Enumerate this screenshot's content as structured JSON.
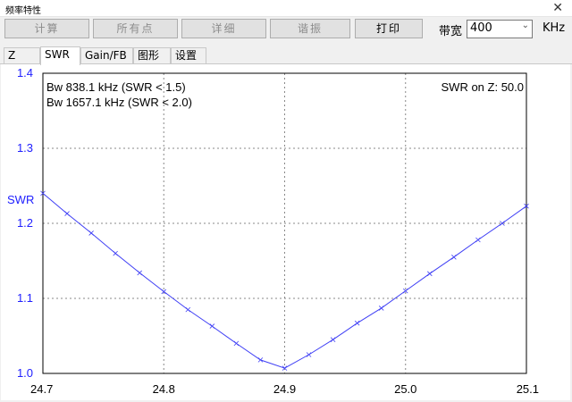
{
  "window": {
    "title": "频率特性",
    "close_glyph": "✕"
  },
  "toolbar": {
    "buttons": [
      {
        "label": "计算",
        "enabled": false
      },
      {
        "label": "所有点",
        "enabled": false
      },
      {
        "label": "详细",
        "enabled": false
      },
      {
        "label": "谐振",
        "enabled": false
      },
      {
        "label": "打印",
        "enabled": true
      }
    ],
    "bandwidth_label": "带宽",
    "bandwidth_value": "400",
    "bandwidth_unit": "KHz"
  },
  "tabs": [
    {
      "label": "Z",
      "active": false
    },
    {
      "label": "SWR",
      "active": true
    },
    {
      "label": "Gain/FB",
      "active": false
    },
    {
      "label": "图形",
      "active": false
    },
    {
      "label": "设置",
      "active": false
    }
  ],
  "annotations": {
    "bw1": "Bw 838.1 kHz (SWR < 1.5)",
    "bw2": "Bw 1657.1 kHz (SWR < 2.0)",
    "z_ref": "SWR on Z: 50.0"
  },
  "colors": {
    "series": "#3f3ff5",
    "axis_label": "#2020ff",
    "grid": "#888888"
  },
  "chart_data": {
    "type": "line",
    "ylabel": "SWR",
    "xlabel": "",
    "xlim": [
      24.7,
      25.1
    ],
    "ylim": [
      1.0,
      1.4
    ],
    "xticks": [
      "24.7",
      "24.8",
      "24.9",
      "25.0",
      "25.1"
    ],
    "yticks": [
      "1.0",
      "1.1",
      "1.2",
      "1.3",
      "1.4"
    ],
    "grid": true,
    "series": [
      {
        "x": [
          24.7,
          24.72,
          24.74,
          24.76,
          24.78,
          24.8,
          24.82,
          24.84,
          24.86,
          24.88,
          24.9,
          24.92,
          24.94,
          24.96,
          24.98,
          25.0,
          25.02,
          25.04,
          25.06,
          25.08,
          25.1
        ],
        "y": [
          1.24,
          1.213,
          1.187,
          1.16,
          1.134,
          1.109,
          1.085,
          1.063,
          1.04,
          1.018,
          1.007,
          1.025,
          1.045,
          1.067,
          1.087,
          1.11,
          1.133,
          1.155,
          1.178,
          1.2,
          1.223
        ]
      }
    ]
  }
}
